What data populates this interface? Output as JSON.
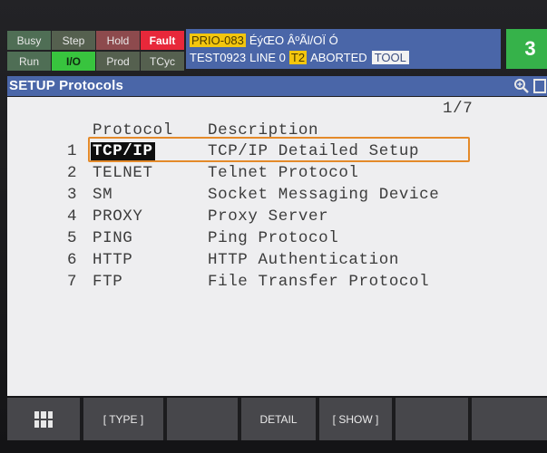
{
  "status": {
    "leds": [
      {
        "label": "Busy",
        "state": "off"
      },
      {
        "label": "Step",
        "state": "off"
      },
      {
        "label": "Hold",
        "state": "off"
      },
      {
        "label": "Fault",
        "state": "on"
      },
      {
        "label": "Run",
        "state": "off"
      },
      {
        "label": "I/O",
        "state": "on"
      },
      {
        "label": "Prod",
        "state": "off"
      },
      {
        "label": "TCyc",
        "state": "off"
      }
    ],
    "message": {
      "alarm_code": "PRIO-083",
      "alarm_text": "ÉýŒO ÂºÃl/OÏ  Ó",
      "program": "TEST0923",
      "line": "LINE 0",
      "mode": "T2",
      "state": "ABORTED",
      "frame": "TOOL"
    },
    "step_value": "3"
  },
  "title": "SETUP Protocols",
  "screen": {
    "page": "1/7",
    "headers": {
      "protocol": "Protocol",
      "description": "Description"
    },
    "rows": [
      {
        "num": "1",
        "protocol": "TCP/IP",
        "description": "TCP/IP Detailed Setup",
        "selected": true
      },
      {
        "num": "2",
        "protocol": "TELNET",
        "description": "Telnet Protocol"
      },
      {
        "num": "3",
        "protocol": "SM",
        "description": "Socket Messaging Device"
      },
      {
        "num": "4",
        "protocol": "PROXY",
        "description": "Proxy Server"
      },
      {
        "num": "5",
        "protocol": "PING",
        "description": "Ping Protocol"
      },
      {
        "num": "6",
        "protocol": "HTTP",
        "description": "HTTP Authentication"
      },
      {
        "num": "7",
        "protocol": "FTP",
        "description": "File Transfer Protocol"
      }
    ]
  },
  "fkeys": {
    "menu_icon": "grid-icon",
    "f1": "[ TYPE ]",
    "f2": "",
    "f3": "DETAIL",
    "f4": "[ SHOW ]",
    "f5": ""
  },
  "colors": {
    "panel_blue": "#4a66a8",
    "fault_red": "#e8283a",
    "io_green": "#38c43e",
    "highlight_orange": "#e48a2a"
  }
}
